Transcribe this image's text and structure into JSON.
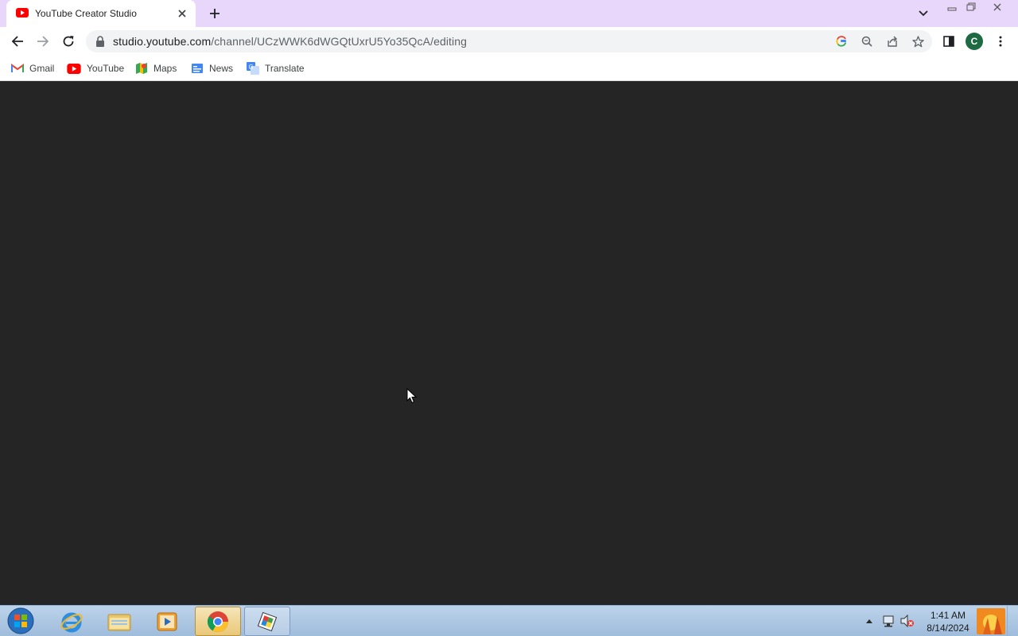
{
  "browser": {
    "tab": {
      "title": "YouTube Creator Studio",
      "favicon": "youtube-icon"
    },
    "toolbar": {
      "url_host": "studio.youtube.com",
      "url_path": "/channel/UCzWWK6dWGQtUxrU5Yo35QcA/editing",
      "profile_initial": "C"
    },
    "bookmarks": [
      {
        "label": "Gmail",
        "icon": "gmail-icon"
      },
      {
        "label": "YouTube",
        "icon": "youtube-icon"
      },
      {
        "label": "Maps",
        "icon": "maps-icon"
      },
      {
        "label": "News",
        "icon": "news-icon"
      },
      {
        "label": "Translate",
        "icon": "translate-icon"
      }
    ]
  },
  "page": {
    "background": "#252525"
  },
  "taskbar": {
    "items": [
      "start-orb-icon",
      "internet-explorer-icon",
      "file-explorer-icon",
      "media-player-icon",
      "chrome-icon",
      "paint-app-icon"
    ],
    "clock": {
      "time": "1:41 AM",
      "date": "8/14/2024"
    }
  },
  "colors": {
    "tab_strip": "#e9d7fb",
    "avatar": "#1e6b43",
    "youtube_red": "#ff0000"
  }
}
